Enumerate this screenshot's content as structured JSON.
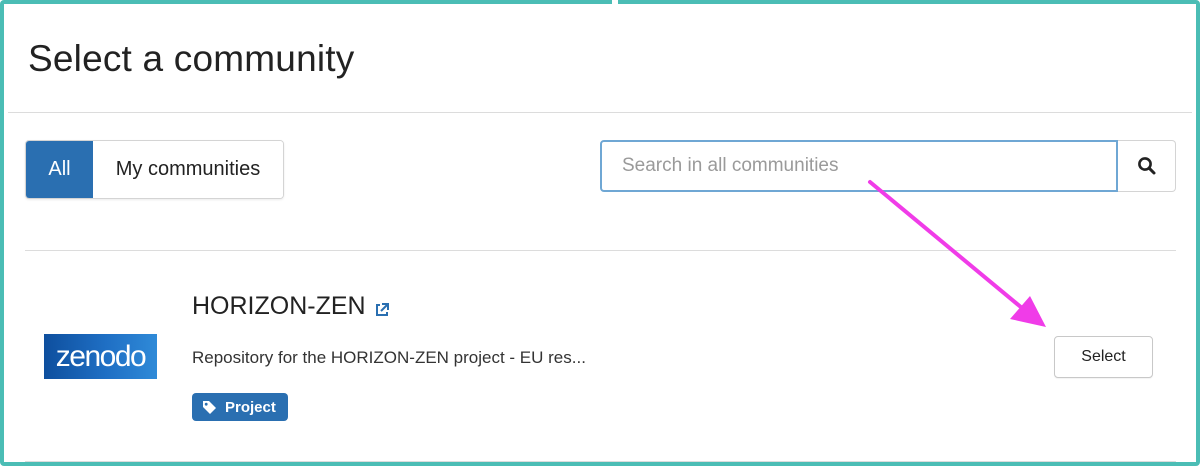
{
  "header": {
    "title": "Select a community"
  },
  "filters": {
    "all_label": "All",
    "mine_label": "My communities",
    "active": "All"
  },
  "search": {
    "placeholder": "Search in all communities",
    "value": ""
  },
  "community": {
    "logo_text": "zenodo",
    "name": "HORIZON-ZEN",
    "description": "Repository for the HORIZON-ZEN project - EU res...",
    "tag_label": "Project",
    "select_label": "Select"
  },
  "colors": {
    "accent": "#2a6fb1",
    "frame_border": "#4bbdb5",
    "annotation_arrow": "#f03ce8",
    "search_focus_border": "#6fa7d4"
  },
  "icons": {
    "search_button": "search-icon",
    "external_link": "external-link-icon",
    "tag": "tag-icon"
  }
}
